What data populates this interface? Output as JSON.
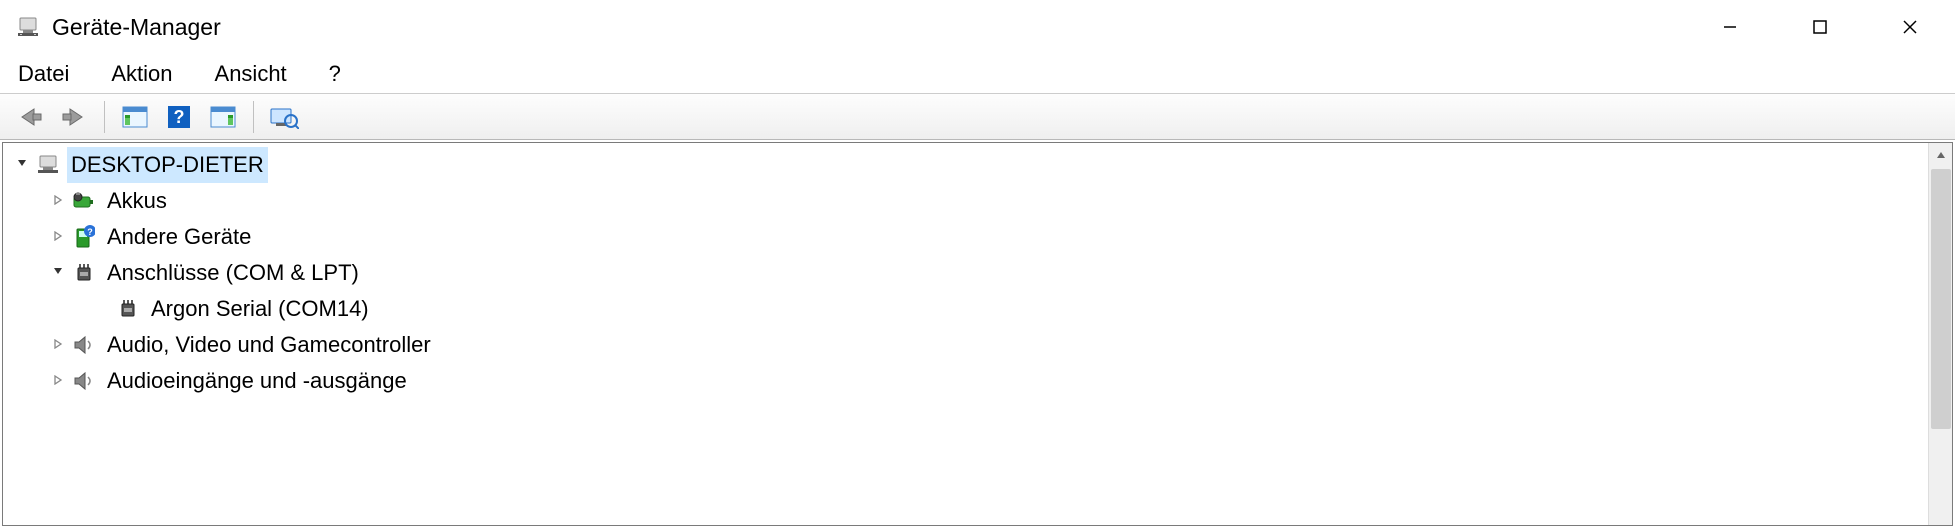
{
  "window": {
    "title": "Geräte-Manager"
  },
  "menu": {
    "file": "Datei",
    "action": "Aktion",
    "view": "Ansicht",
    "help": "?"
  },
  "tree": {
    "root": {
      "label": "DESKTOP-DIETER"
    },
    "items": [
      {
        "label": "Akkus",
        "expanded": false
      },
      {
        "label": "Andere Geräte",
        "expanded": false
      },
      {
        "label": "Anschlüsse (COM & LPT)",
        "expanded": true,
        "children": [
          {
            "label": "Argon Serial (COM14)"
          }
        ]
      },
      {
        "label": "Audio, Video und Gamecontroller",
        "expanded": false
      },
      {
        "label": "Audioeingänge und -ausgänge",
        "expanded": false
      }
    ]
  }
}
